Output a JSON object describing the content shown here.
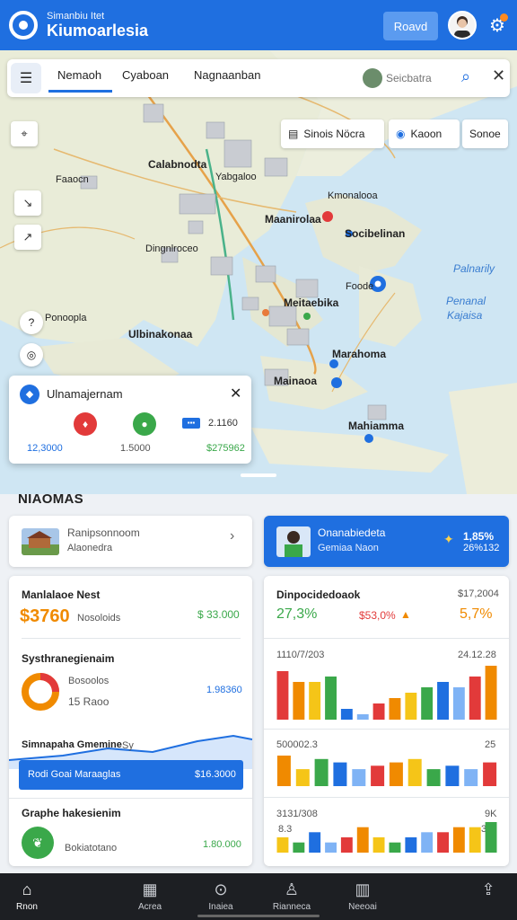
{
  "header": {
    "subtitle": "Simanbiu Itet",
    "title": "Kiumoarlesia",
    "action_label": "Roavd",
    "colors": {
      "brand": "#1f6fe0",
      "badge": "#ff8a1f"
    }
  },
  "tabs": {
    "items": [
      {
        "label": "Nemaoh",
        "active": true
      },
      {
        "label": "Cyaboan",
        "active": false
      },
      {
        "label": "Nagnaanban",
        "active": false
      }
    ],
    "search": {
      "placeholder": "Seicbatra"
    }
  },
  "map": {
    "layers": [
      {
        "label": "Sinois Nöcra",
        "icon": "list-icon"
      },
      {
        "label": "Kaoon",
        "icon": "layers-icon"
      },
      {
        "label": "Sonoe",
        "icon": ""
      }
    ],
    "labels": {
      "l1": "Calabnodta",
      "l2": "Yabgaloo",
      "l3": "Faaocn",
      "l4": "Kmonalooa",
      "l5": "Maanirolaa",
      "l6": "Socibelinan",
      "l7": "Dingnlroceo",
      "l8": "Foode",
      "l9": "Palnarily",
      "l10": "Penanal",
      "l11": "Kajaisa",
      "l12": "Meitaebika",
      "l13": "Ponoopla",
      "l14": "Ulbinakonaa",
      "l15": "Marahoma",
      "l16": "Mainaoa",
      "l17": "Mahiamma"
    }
  },
  "popup": {
    "title": "Ulnamajernam",
    "badge": "▪▪▪",
    "badge_text": "2.1160",
    "values": [
      "12,3000",
      "1.5000",
      "$275962"
    ],
    "colors": {
      "left": "#1f6fe0",
      "mid": "#333333",
      "right": "#3aa84a"
    }
  },
  "section": {
    "title": "NIAOMAS",
    "card_place": {
      "title": "Ranipsonnoom",
      "subtitle": "Alaonedra"
    },
    "card_highlight": {
      "title": "Onanabiedeta",
      "subtitle": "Gemiaa Naon",
      "value1": "1,85%",
      "value2": "26%132"
    },
    "card_metrics": {
      "title": "Manlalaoe Nest",
      "value_main": "$3760",
      "value_sub": "Nosoloids",
      "value_right": "$ 33.000",
      "row2_title": "Systhranegienaim",
      "row2_a": "Bosoolos",
      "row2_b": "15 Raoo",
      "row2_value": "1.98360",
      "row3_title": "Simnapaha Gmemine",
      "row3_sub": "Sy",
      "bar_left": "Rodi Goai",
      "bar_mid": "Maraaglas",
      "bar_value": "$16.3000",
      "row4_title": "Graphe hakesienim",
      "row4_sub": "Bokiatotano",
      "row4_value": "1.80.000"
    },
    "card_charts": {
      "title": "Dinpocidedoaok",
      "title_value": "$17,2004",
      "stat1": "27,3%",
      "stat2": "$53,0%",
      "stat3": "5,7%",
      "chart1_label": "1110/7/203",
      "chart1_value": "24.12.28",
      "chart2_label": "500002.3",
      "chart2_value": "25",
      "chart3_label": "3131/308",
      "chart3_value": "9K",
      "chart3_sub_left": "8.3",
      "chart3_sub_right": "39"
    }
  },
  "chart_data": [
    {
      "type": "bar",
      "values": [
        9,
        7,
        7,
        8,
        2,
        1,
        3,
        4,
        5,
        6,
        7,
        6,
        8,
        10
      ]
    },
    {
      "type": "bar",
      "values": [
        9,
        5,
        8,
        7,
        5,
        6,
        7,
        8,
        5,
        6,
        5,
        7
      ]
    },
    {
      "type": "bar",
      "values": [
        3,
        2,
        4,
        2,
        3,
        5,
        3,
        2,
        3,
        4,
        4,
        5,
        5,
        6
      ]
    }
  ],
  "bottom_nav": [
    {
      "label": "Rnon",
      "icon": "home-icon",
      "active": true
    },
    {
      "label": "Acrea",
      "icon": "map-icon",
      "active": false
    },
    {
      "label": "Inaiea",
      "icon": "compass-icon",
      "active": false
    },
    {
      "label": "Rianneca",
      "icon": "user-icon",
      "active": false
    },
    {
      "label": "Neeoai",
      "icon": "book-icon",
      "active": false
    },
    {
      "label": "",
      "icon": "share-icon",
      "active": false
    }
  ]
}
